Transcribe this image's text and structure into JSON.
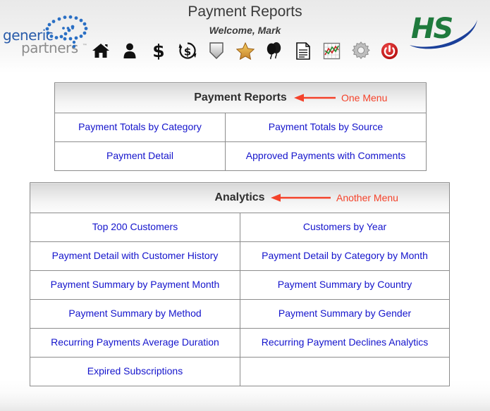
{
  "page": {
    "title": "Payment Reports",
    "welcome": "Welcome, Mark"
  },
  "branding": {
    "left_logo": {
      "word1": "generic",
      "word2": "partners",
      "trademark": "™",
      "color1": "#2a5caa",
      "color2": "#8c8c8c",
      "mark": "dotted-infinity-loop"
    },
    "right_logo": {
      "text": "HS",
      "text_color": "#1f7a3d",
      "swoosh_color": "#1a3f99"
    }
  },
  "toolbar": {
    "icons": [
      {
        "name": "home-icon",
        "label": "Home"
      },
      {
        "name": "person-icon",
        "label": "Customers"
      },
      {
        "name": "dollar-icon",
        "label": "Payments"
      },
      {
        "name": "recurring-dollar-icon",
        "label": "Recurring Payments"
      },
      {
        "name": "shield-icon",
        "label": "Security"
      },
      {
        "name": "star-icon",
        "label": "Favorites"
      },
      {
        "name": "balloons-icon",
        "label": "Events"
      },
      {
        "name": "document-icon",
        "label": "Reports"
      },
      {
        "name": "chart-icon",
        "label": "Analytics"
      },
      {
        "name": "gear-icon",
        "label": "Settings"
      },
      {
        "name": "power-icon",
        "label": "Log Out"
      }
    ]
  },
  "menus": [
    {
      "id": "payment-reports",
      "heading": "Payment Reports",
      "annotation": "One Menu",
      "annotation_color": "#f4422a",
      "rows": [
        [
          "Payment Totals by Category",
          "Payment Totals by Source"
        ],
        [
          "Payment Detail",
          "Approved Payments with Comments"
        ]
      ]
    },
    {
      "id": "analytics",
      "heading": "Analytics",
      "annotation": "Another Menu",
      "annotation_color": "#f4422a",
      "rows": [
        [
          "Top 200 Customers",
          "Customers by Year"
        ],
        [
          "Payment Detail with Customer History",
          "Payment Detail by Category by Month"
        ],
        [
          "Payment Summary by Payment Month",
          "Payment Summary by Country"
        ],
        [
          "Payment Summary by Method",
          "Payment Summary by Gender"
        ],
        [
          "Recurring Payments Average Duration",
          "Recurring Payment Declines Analytics"
        ],
        [
          "Expired Subscriptions",
          ""
        ]
      ]
    }
  ],
  "colors": {
    "link": "#1414cc",
    "heading": "#2e2e2e",
    "annotation": "#f4422a",
    "border": "#8c8c8c"
  }
}
